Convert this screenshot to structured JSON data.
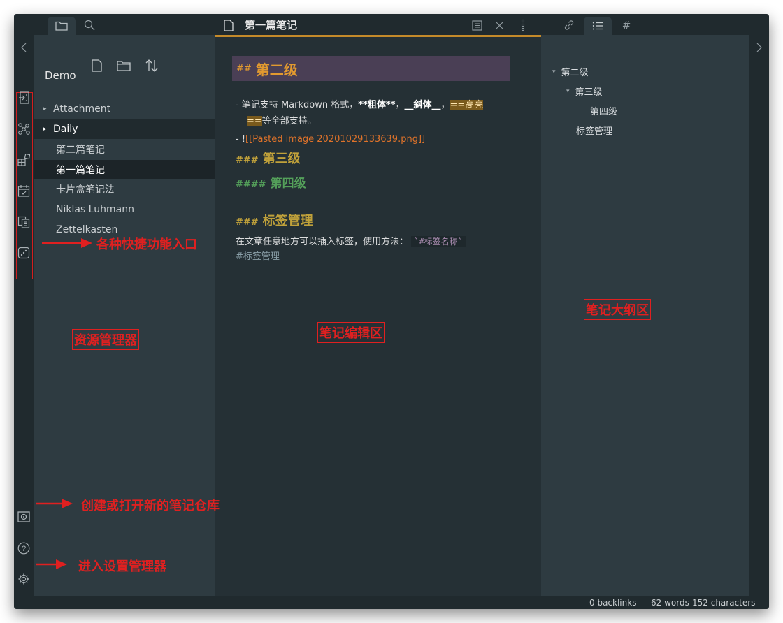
{
  "topbar": {
    "note_title": "第一篇笔记",
    "left_tabs": [
      "folder-icon",
      "search-icon"
    ],
    "right_tabs": [
      "link-icon",
      "list-icon",
      "hash-icon"
    ],
    "hash_label": "#"
  },
  "ribbon": {
    "items": [
      "open-quick-switcher-icon",
      "graph-view-icon",
      "templates-icon",
      "daily-note-icon",
      "note-composer-icon",
      "random-note-icon"
    ],
    "bottom": [
      "vault-icon",
      "help-icon",
      "settings-icon"
    ],
    "help_label": "?"
  },
  "explorer": {
    "tools": [
      "new-note-icon",
      "new-folder-icon",
      "sort-icon"
    ],
    "vault_name": "Demo",
    "folders": [
      {
        "label": "Attachment",
        "caret": "▸"
      },
      {
        "label": "Daily",
        "caret": "▸"
      }
    ],
    "files": [
      "第二篇笔记",
      "第一篇笔记",
      "卡片盒笔记法",
      "Niklas Luhmann",
      "Zettelkasten"
    ],
    "active_file": "第一篇笔记"
  },
  "editor": {
    "h2_mark": "##",
    "h2_text": "第二级",
    "line1_prefix": "- 笔记支持 Markdown 格式，",
    "line1_bold": "**粗体**",
    "line1_sep1": "，",
    "line1_italic": "__斜体__",
    "line1_sep2": "，",
    "line1_hl_a": "==高亮",
    "line1_hl_b": "==",
    "line1_suffix": "等全部支持。",
    "line2_prefix": "- !",
    "line2_link": "[[Pasted image 20201029133639.png]]",
    "h3a_mark": "###",
    "h3a_text": "第三级",
    "h4_mark": "####",
    "h4_text": "第四级",
    "h3b_mark": "###",
    "h3b_text": "标签管理",
    "para_text": "在文章任意地方可以插入标签，使用方法：",
    "code_text": "`#标签名称`",
    "tag_text": "#标签管理"
  },
  "outline": {
    "items": [
      {
        "label": "第二级",
        "caret": "▾"
      },
      {
        "label": "第三级",
        "caret": "▾"
      },
      {
        "label": "第四级",
        "caret": ""
      },
      {
        "label": "标签管理",
        "caret": ""
      }
    ]
  },
  "status": {
    "backlinks": "0 backlinks",
    "words": "62 words",
    "characters": "152 characters"
  },
  "annotations": {
    "ribbon": "各种快捷功能入口",
    "explorer": "资源管理器",
    "editor": "笔记编辑区",
    "outline": "笔记大纲区",
    "vault": "创建或打开新的笔记仓库",
    "settings": "进入设置管理器"
  },
  "colors": {
    "accent": "#c48a2a",
    "annotation": "#e02020",
    "h2": "#e29a2f",
    "h3": "#c0a13a",
    "h4": "#54a05a",
    "link": "#e0732a"
  }
}
